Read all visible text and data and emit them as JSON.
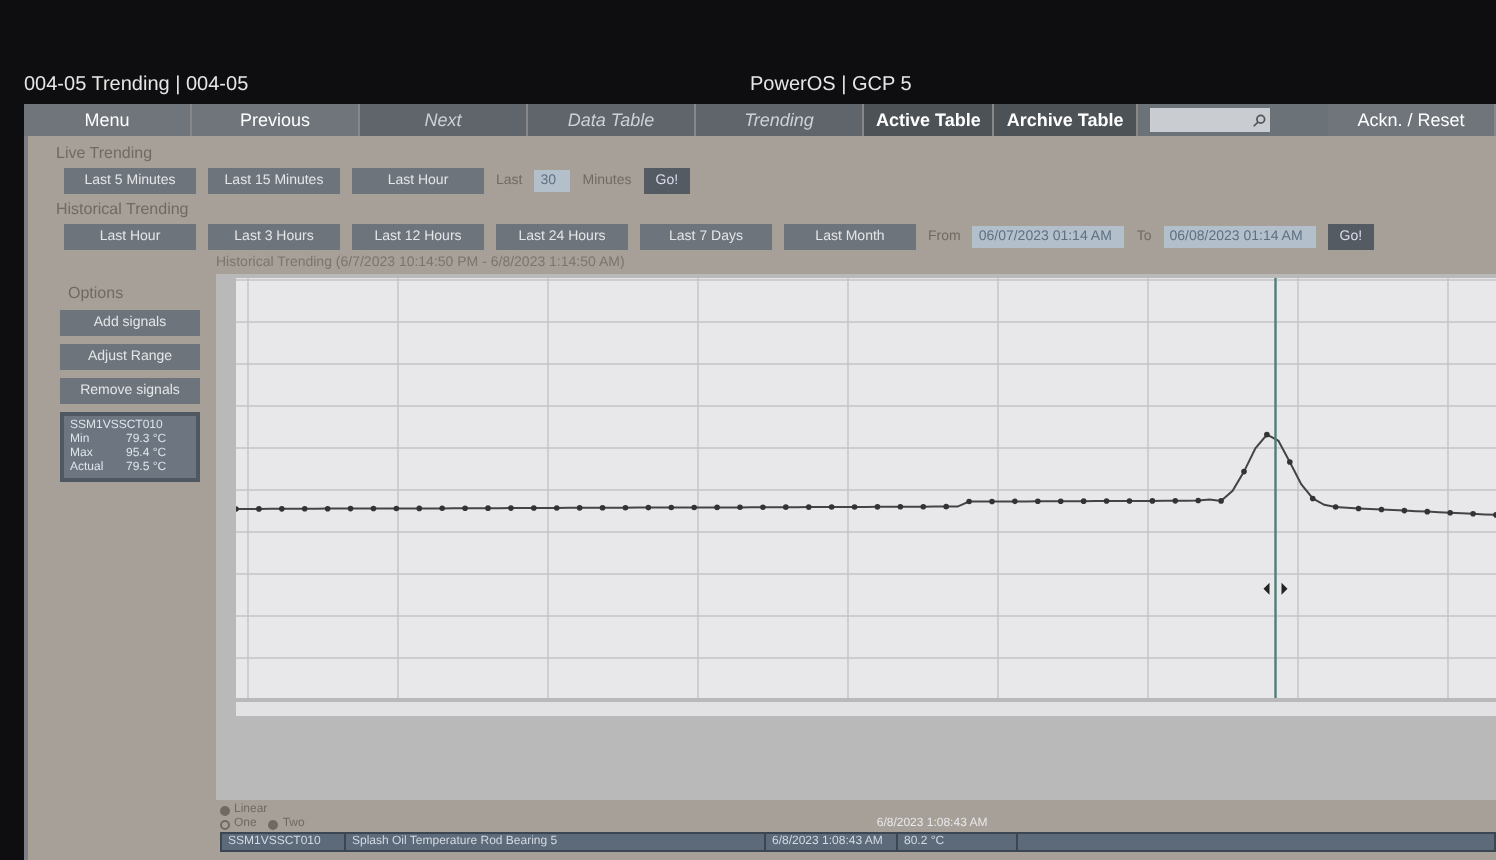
{
  "window": {
    "title": "004-05  Trending | 004-05",
    "system": "PowerOS | GCP 5"
  },
  "nav": [
    {
      "label": "Menu",
      "disabled": false
    },
    {
      "label": "Previous",
      "disabled": false
    },
    {
      "label": "Next",
      "disabled": true
    },
    {
      "label": "Data Table",
      "disabled": true
    },
    {
      "label": "Trending",
      "disabled": true
    },
    {
      "label": "Active Table",
      "disabled": false
    },
    {
      "label": "Archive Table",
      "disabled": false
    }
  ],
  "ack_button": "Ackn. / Reset",
  "live": {
    "title": "Live Trending",
    "buttons": [
      "Last 5 Minutes",
      "Last 15 Minutes",
      "Last Hour"
    ],
    "last_label": "Last",
    "minutes_value": "30",
    "minutes_label": "Minutes",
    "go": "Go!"
  },
  "historical": {
    "title": "Historical Trending",
    "buttons": [
      "Last Hour",
      "Last 3 Hours",
      "Last 12 Hours",
      "Last 24 Hours",
      "Last 7 Days",
      "Last Month"
    ],
    "from_label": "From",
    "from_value": "06/07/2023 01:14 AM",
    "to_label": "To",
    "to_value": "06/08/2023 01:14 AM",
    "go": "Go!"
  },
  "options": {
    "title": "Options",
    "buttons": [
      "Add signals",
      "Adjust Range",
      "Remove signals"
    ]
  },
  "signal_card": {
    "tag": "SSM1VSSCT010",
    "rows": [
      {
        "label": "Min",
        "value": "79.3 °C"
      },
      {
        "label": "Max",
        "value": "95.4 °C"
      },
      {
        "label": "Actual",
        "value": "79.5 °C"
      }
    ]
  },
  "chart": {
    "title": "Historical Trending (6/7/2023 10:14:50 PM - 6/8/2023 1:14:50 AM)"
  },
  "scale": {
    "options": [
      {
        "label": "Linear",
        "selected": true
      }
    ]
  },
  "view": [
    {
      "label": "One",
      "selected": false
    },
    {
      "label": "Two",
      "selected": true
    }
  ],
  "cursor_time": "6/8/2023 1:08:43 AM",
  "signal_row": {
    "tag": "SSM1VSSCT010",
    "description": "Splash Oil Temperature Rod Bearing 5",
    "time": "6/8/2023 1:08:43 AM",
    "value": "80.2 °C"
  }
}
